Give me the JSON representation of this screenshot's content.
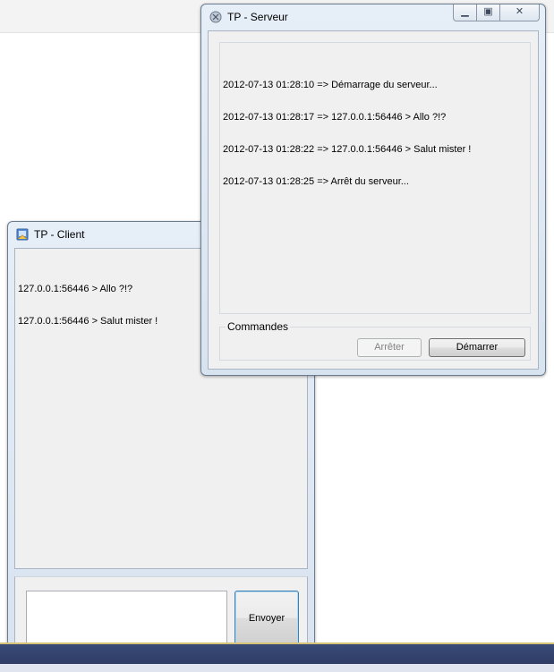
{
  "client_window": {
    "title": "TP - Client",
    "messages": [
      "127.0.0.1:56446 > Allo ?!?",
      "127.0.0.1:56446 > Salut mister !"
    ],
    "message_input": {
      "value": "",
      "placeholder": ""
    },
    "send_button_label": "Envoyer"
  },
  "server_window": {
    "title": "TP - Serveur",
    "log": [
      "2012-07-13 01:28:10 => Démarrage du serveur...",
      "2012-07-13 01:28:17 => 127.0.0.1:56446 > Allo ?!?",
      "2012-07-13 01:28:22 => 127.0.0.1:56446 > Salut mister !",
      "2012-07-13 01:28:25 => Arrêt du serveur..."
    ],
    "commands_group_label": "Commandes",
    "stop_button_label": "Arrêter",
    "start_button_label": "Démarrer"
  },
  "icons": {
    "client_app": "client-app-icon",
    "server_app": "server-app-icon",
    "minimize": "minimize-icon",
    "maximize": "maximize-icon",
    "close": "close-icon"
  },
  "colors": {
    "window_frame": "#d8e3f0",
    "client_background": "#f0f0f0",
    "taskbar": "#2a365c"
  }
}
